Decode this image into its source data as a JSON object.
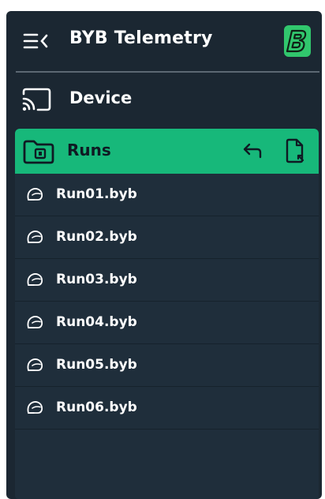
{
  "header": {
    "title": "BYB Telemetry",
    "menu_icon": "menu-collapse-icon",
    "logo_icon": "byb-logo-icon"
  },
  "nav": {
    "device": {
      "label": "Device",
      "icon": "cast-icon"
    },
    "runs": {
      "label": "Runs",
      "icon": "folder-icon",
      "actions": [
        {
          "icon": "undo-arrow-icon"
        },
        {
          "icon": "file-export-icon"
        }
      ]
    }
  },
  "runs": {
    "item_icon": "helmet-icon",
    "items": [
      {
        "name": "Run01.byb"
      },
      {
        "name": "Run02.byb"
      },
      {
        "name": "Run03.byb"
      },
      {
        "name": "Run04.byb"
      },
      {
        "name": "Run05.byb"
      },
      {
        "name": "Run06.byb"
      }
    ]
  },
  "colors": {
    "panel_bg": "#1b2732",
    "accent": "#17b87a",
    "list_bg": "#1f2e3b",
    "text": "#ffffff"
  }
}
